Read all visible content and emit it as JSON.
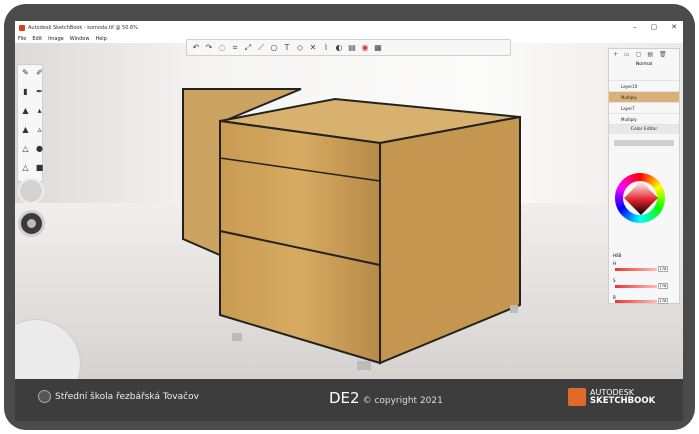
{
  "window": {
    "title": "Autodesk SketchBook - komoda.tif @ 50.6%",
    "controls": [
      "–",
      "▢",
      "✕"
    ]
  },
  "menu": [
    "File",
    "Edit",
    "Image",
    "Window",
    "Help"
  ],
  "toolbar": {
    "icons": [
      "undo",
      "redo",
      "select",
      "crop",
      "transform",
      "ruler",
      "ellipse",
      "text",
      "perspective",
      "symmetry",
      "steady-stroke",
      "copic",
      "brush-library",
      "color-puck",
      "layers"
    ]
  },
  "layers": {
    "blend": "Normal",
    "rows": [
      "Layer10",
      "Multiply",
      "Layer7",
      "Multiply"
    ]
  },
  "color_editor": {
    "title": "Color Editor",
    "mode": "HSB",
    "values": [
      "178",
      "178",
      "178"
    ],
    "labels": [
      "H",
      "S",
      "B"
    ]
  },
  "footer": {
    "school": "Střední škola řezbářská Tovačov",
    "course": "DE2",
    "copyright": "© copyright 2021",
    "brand1": "AUTODESK",
    "brand2": "SKETCHBOOK"
  }
}
